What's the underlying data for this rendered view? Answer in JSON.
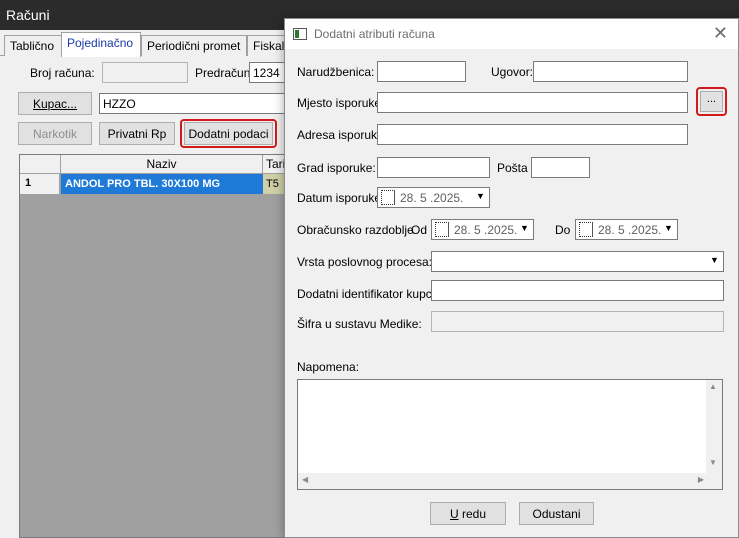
{
  "window": {
    "title": "Računi"
  },
  "tabs": [
    "Tablično",
    "Pojedinačno",
    "Periodični promet",
    "Fiskaliz"
  ],
  "main": {
    "broj_racuna_label": "Broj računa:",
    "broj_racuna_value": "",
    "predracun_label": "Predračun:",
    "predracun_value": "1234",
    "kupac_button": "Kupac...",
    "kupac_value": "HZZO",
    "narkotik_button": "Narkotik",
    "privatni_rp_button": "Privatni Rp",
    "dodatni_podaci_button": "Dodatni podaci",
    "grid": {
      "headers": [
        "",
        "Naziv",
        "Tari"
      ],
      "rows": [
        {
          "num": "1",
          "naziv": "ANDOL PRO TBL. 30X100 MG",
          "tarifa": "T5"
        }
      ]
    }
  },
  "dialog": {
    "title": "Dodatni atributi računa",
    "close_glyph": "✕",
    "narudzbenica_label": "Narudžbenica:",
    "narudzbenica_value": "",
    "ugovor_label": "Ugovor:",
    "ugovor_value": "",
    "mjesto_label": "Mjesto isporuke:",
    "mjesto_value": "",
    "browse_button": "...",
    "adresa_label": "Adresa isporuke:",
    "adresa_value": "",
    "grad_label": "Grad isporuke:",
    "grad_value": "",
    "posta_label": "Pošta",
    "posta_value": "",
    "datum_label": "Datum isporuke:",
    "datum_value": "28. 5 .2025.",
    "razdoblje_label": "Obračunsko razdoblje",
    "od_label": "Od",
    "od_value": "28. 5 .2025.",
    "do_label": "Do",
    "do_value": "28. 5 .2025.",
    "vrsta_label": "Vrsta poslovnog procesa:",
    "vrsta_value": "",
    "identifikator_label": "Dodatni identifikator kupca:",
    "identifikator_value": "",
    "sifra_label": "Šifra u sustavu Medike:",
    "sifra_value": "",
    "napomena_label": "Napomena:",
    "napomena_value": "",
    "ok_mnemonic": "U",
    "ok_rest": " redu",
    "cancel_button": "Odustani"
  },
  "colors": {
    "selection": "#1e7ad6",
    "highlight": "#d11b1b",
    "tariff_cell": "#cfcfa8"
  }
}
